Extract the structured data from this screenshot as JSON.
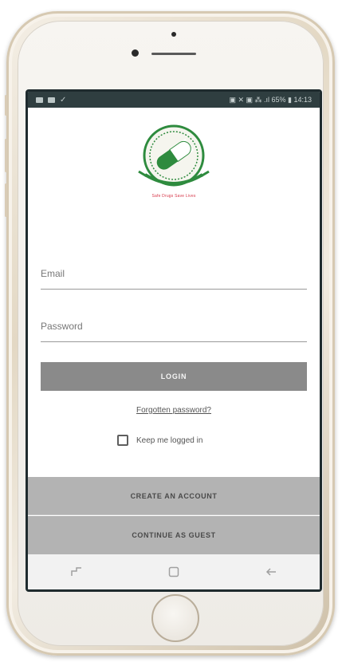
{
  "statusbar": {
    "status_text": "▣ ✕ ▣ ⁂ .ıl 65% ▮ 14:13"
  },
  "logo": {
    "tagline": "Safe Drugs Save Lives"
  },
  "form": {
    "email_placeholder": "Email",
    "password_placeholder": "Password",
    "login_label": "LOGIN",
    "forgot_label": "Forgotten password?",
    "keep_logged_in_label": "Keep me logged in"
  },
  "actions": {
    "create_account_label": "CREATE AN ACCOUNT",
    "continue_guest_label": "CONTINUE AS GUEST"
  },
  "navbar": {
    "icons": [
      "recent-apps-icon",
      "home-icon",
      "back-icon"
    ]
  },
  "colors": {
    "login_button": "#8a8a8a",
    "bottom_buttons": "#b3b3b3",
    "logo_green": "#2e8b3e",
    "tagline_red": "#d7384a",
    "statusbar": "#2f3e40"
  }
}
